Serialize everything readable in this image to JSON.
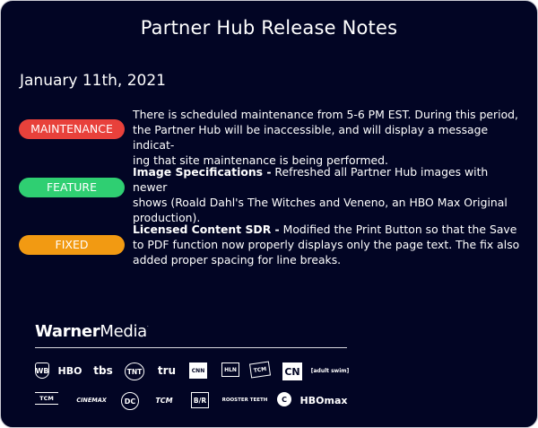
{
  "header": {
    "title": "Partner Hub Release Notes"
  },
  "release": {
    "date": "January 11th, 2021",
    "notes": [
      {
        "badge": "MAINTENANCE",
        "heading": "",
        "lines": [
          "There is scheduled maintenance from 5-6 PM EST. During this period,",
          "the Partner Hub will be inaccessible, and will display a message indicat-",
          "ing that site maintenance is being performed."
        ]
      },
      {
        "badge": "FEATURE",
        "heading": "Image Specifications -",
        "lines": [
          " Refreshed all Partner Hub images with newer",
          "shows (Roald Dahl's The Witches and Veneno, an HBO Max Original",
          "production)."
        ]
      },
      {
        "badge": "FIXED",
        "heading": "Licensed Content SDR -",
        "lines": [
          " Modified the Print Button so that the Save",
          "to PDF function now properly displays only the page text. The fix also",
          "added proper spacing for line breaks."
        ]
      }
    ]
  },
  "footer": {
    "brand_bold": "Warner",
    "brand_light": "Media",
    "brand_mark": "·",
    "logos_row1": [
      "WB",
      "HBO",
      "tbs",
      "TNT",
      "tru",
      "CNN",
      "HLN",
      "TCM",
      "CN",
      "[adult swim]"
    ],
    "logos_row2": [
      "TCM",
      "CINEMAX",
      "DC",
      "TCM",
      "B/R",
      "ROOSTER TEETH",
      "C",
      "HBOmax"
    ]
  },
  "colors": {
    "background": "#020524",
    "maintenance": "#e8413b",
    "feature": "#2fcf72",
    "fixed": "#f29a12"
  }
}
